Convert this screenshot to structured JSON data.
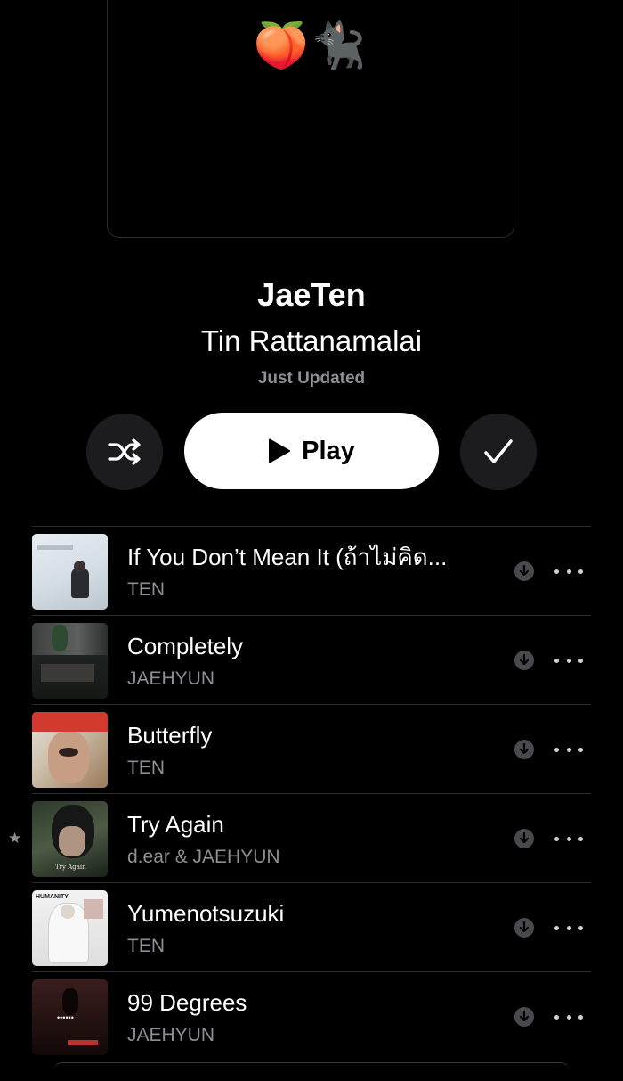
{
  "playlist": {
    "art_emoji": "🍑🐈‍⬛",
    "title": "JaeTen",
    "curator": "Tin Rattanamalai",
    "status": "Just Updated"
  },
  "controls": {
    "shuffle_icon": "shuffle-icon",
    "play_label": "Play",
    "check_icon": "checkmark-icon"
  },
  "tracks": [
    {
      "title": "If You Don’t Mean It (ถ้าไม่คิด...",
      "artist": "TEN",
      "favorite": false
    },
    {
      "title": "Completely",
      "artist": "JAEHYUN",
      "favorite": false
    },
    {
      "title": "Butterfly",
      "artist": "TEN",
      "favorite": false
    },
    {
      "title": "Try Again",
      "artist": "d.ear & JAEHYUN",
      "favorite": true,
      "art_text": "Try Again"
    },
    {
      "title": "Yumenotsuzuki",
      "artist": "TEN",
      "favorite": false,
      "art_text": "HUMANITY"
    },
    {
      "title": "99 Degrees",
      "artist": "JAEHYUN",
      "favorite": false,
      "art_text": "••••••"
    }
  ],
  "icons": {
    "download": "download-circle-icon",
    "more": "more-ellipsis-icon",
    "favorite": "star-icon"
  },
  "colors": {
    "background": "#000000",
    "secondary_text": "#8e8e93",
    "button_bg": "#1c1c1e",
    "play_bg": "#ffffff"
  }
}
